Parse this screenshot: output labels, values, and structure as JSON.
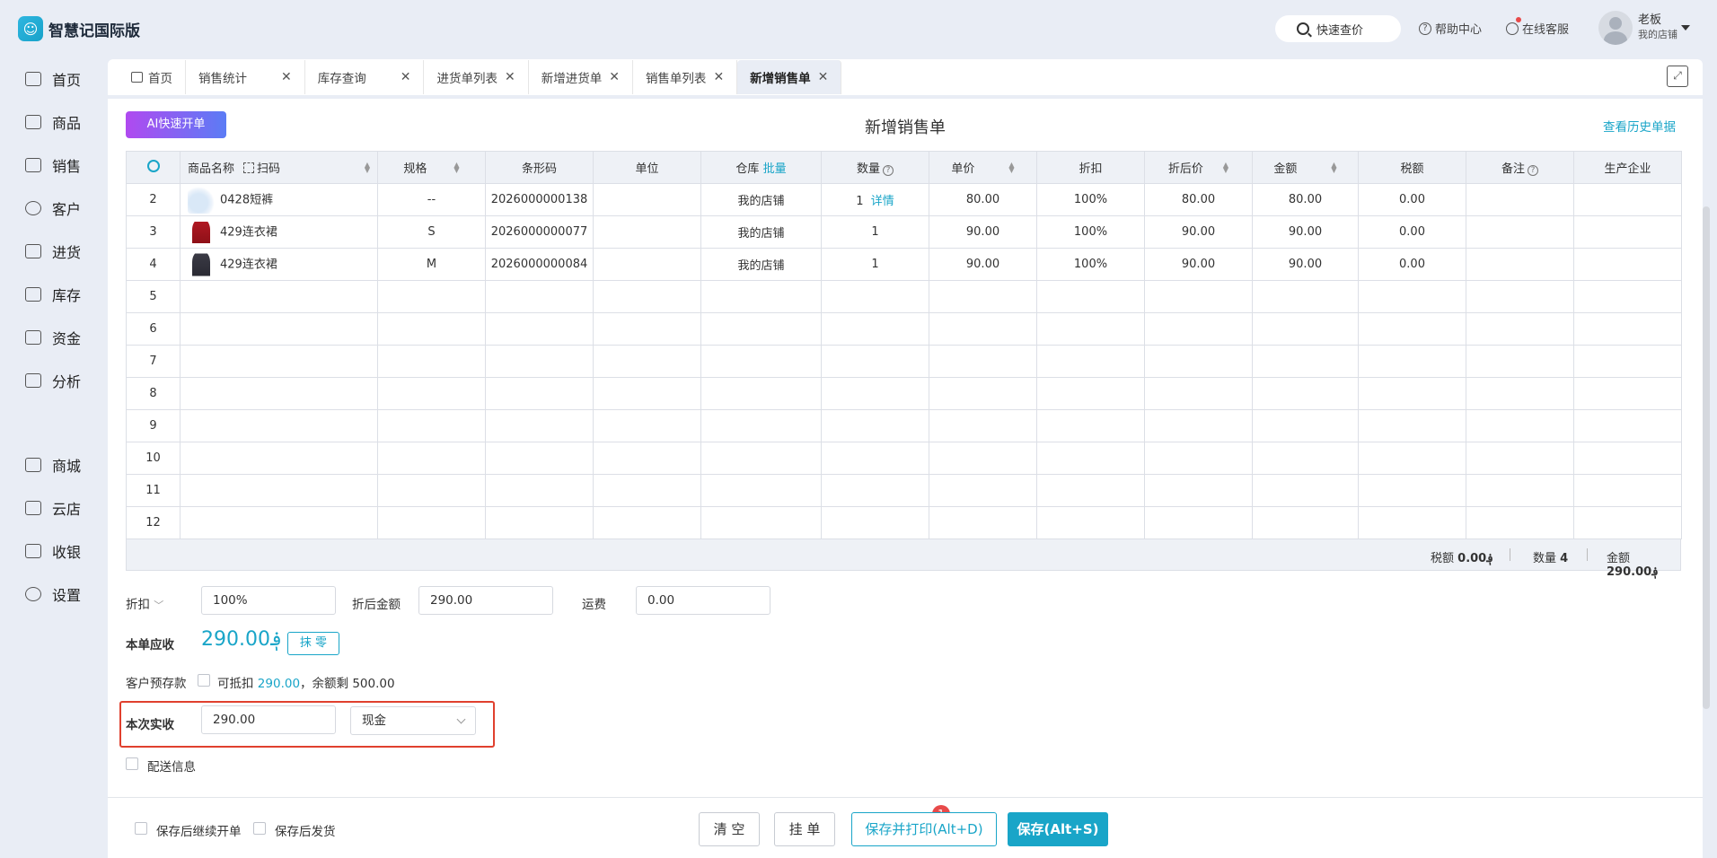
{
  "app": {
    "name": "智慧记国际版",
    "logo_glyph": "☺"
  },
  "topbar": {
    "search_label": "快速查价",
    "help_label": "帮助中心",
    "service_label": "在线客服",
    "user_name": "老板",
    "user_shop": "我的店铺"
  },
  "sidebar": {
    "items": [
      {
        "label": "首页",
        "icon": "home-icon"
      },
      {
        "label": "商品",
        "icon": "bag-icon"
      },
      {
        "label": "销售",
        "icon": "receipt-icon"
      },
      {
        "label": "客户",
        "icon": "person-icon"
      },
      {
        "label": "进货",
        "icon": "purchase-icon"
      },
      {
        "label": "库存",
        "icon": "warehouse-icon"
      },
      {
        "label": "资金",
        "icon": "wallet-icon"
      },
      {
        "label": "分析",
        "icon": "chart-icon"
      },
      {
        "label": "商城",
        "icon": "shop-icon"
      },
      {
        "label": "云店",
        "icon": "cloud-shop-icon"
      },
      {
        "label": "收银",
        "icon": "cashier-icon"
      },
      {
        "label": "设置",
        "icon": "gear-icon"
      }
    ]
  },
  "tabs": [
    {
      "label": "首页"
    },
    {
      "label": "销售统计"
    },
    {
      "label": "库存查询"
    },
    {
      "label": "进货单列表"
    },
    {
      "label": "新增进货单"
    },
    {
      "label": "销售单列表"
    },
    {
      "label": "新增销售单"
    }
  ],
  "page": {
    "ai_button": "AI快速开单",
    "title": "新增销售单",
    "history_link": "查看历史单据"
  },
  "grid": {
    "headers": {
      "name": "商品名称",
      "scan": "扫码",
      "spec": "规格",
      "barcode": "条形码",
      "unit": "单位",
      "warehouse": "仓库",
      "batch": "批量",
      "qty": "数量",
      "price": "单价",
      "discount": "折扣",
      "discounted_price": "折后价",
      "amount": "金额",
      "tax": "税额",
      "remark": "备注",
      "maker": "生产企业"
    },
    "rows": [
      {
        "no": "2",
        "name": "0428短裤",
        "spec": "--",
        "barcode": "2026000000138",
        "warehouse": "我的店铺",
        "qty": "1",
        "detail": "详情",
        "price": "80.00",
        "discount": "100%",
        "discounted_price": "80.00",
        "amount": "80.00",
        "tax": "0.00"
      },
      {
        "no": "3",
        "name": "429连衣裙",
        "spec": "S",
        "barcode": "2026000000077",
        "warehouse": "我的店铺",
        "qty": "1",
        "detail": "",
        "price": "90.00",
        "discount": "100%",
        "discounted_price": "90.00",
        "amount": "90.00",
        "tax": "0.00"
      },
      {
        "no": "4",
        "name": "429连衣裙",
        "spec": "M",
        "barcode": "2026000000084",
        "warehouse": "我的店铺",
        "qty": "1",
        "detail": "",
        "price": "90.00",
        "discount": "100%",
        "discounted_price": "90.00",
        "amount": "90.00",
        "tax": "0.00"
      }
    ],
    "empty_rows": [
      "5",
      "6",
      "7",
      "8",
      "9",
      "10",
      "11",
      "12"
    ]
  },
  "summary": {
    "tax_label": "税额",
    "tax_value": "0.00؋",
    "qty_label": "数量",
    "qty_value": "4",
    "amount_label": "金额",
    "amount_value": "290.00؋"
  },
  "form": {
    "discount_label": "折扣",
    "discount_value": "100%",
    "after_discount_label": "折后金额",
    "after_discount_value": "290.00",
    "freight_label": "运费",
    "freight_value": "0.00",
    "receivable_label": "本单应收",
    "receivable_value": "290.00؋",
    "zero_button": "抹 零",
    "prepaid_label": "客户预存款",
    "deductible_label": "可抵扣",
    "deductible_value": "290.00",
    "balance_text": "，余额剩 500.00",
    "actual_label": "本次实收",
    "actual_value": "290.00",
    "payment_method": "现金",
    "delivery_label": "配送信息"
  },
  "footer": {
    "continue_label": "保存后继续开单",
    "ship_label": "保存后发货",
    "clear_button": "清 空",
    "hold_button": "挂 单",
    "hold_badge": "1",
    "save_print_button": "保存并打印(Alt+D)",
    "save_button": "保存(Alt+S)"
  },
  "colors": {
    "accent": "#19a5c8",
    "highlight_border": "#e0402e",
    "badge": "#e84a4a"
  }
}
